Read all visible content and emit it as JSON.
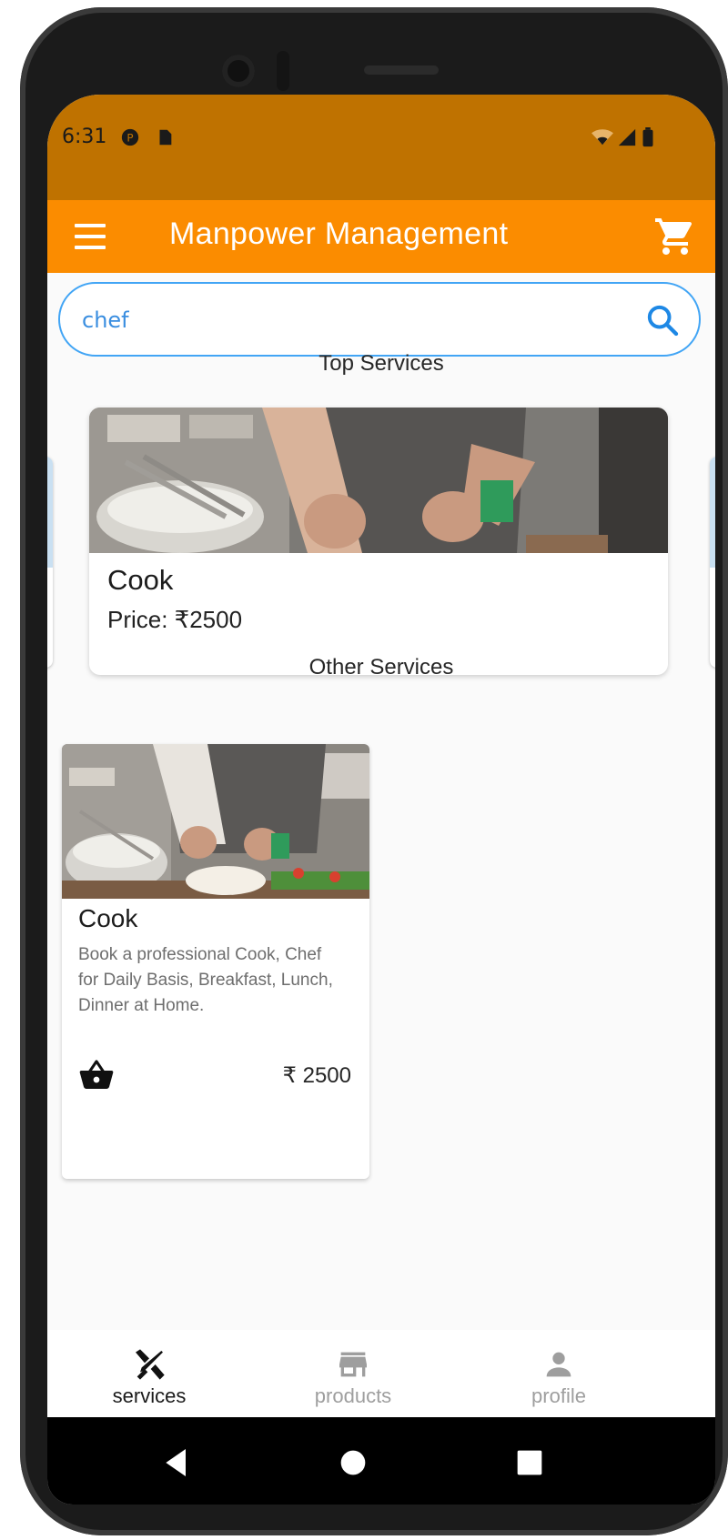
{
  "status_bar": {
    "time": "6:31"
  },
  "app_bar": {
    "title": "Manpower Management",
    "color": "#fb8c00",
    "status_color": "#bf7200"
  },
  "search": {
    "value": "chef",
    "placeholder": ""
  },
  "top_services": {
    "heading": "Top Services",
    "card": {
      "name": "Cook",
      "price": "Price: ₹2500"
    }
  },
  "other_services": {
    "heading": "Other Services",
    "card": {
      "name": "Cook",
      "description": "Book a professional Cook, Chef for Daily Basis, Breakfast, Lunch, Dinner at Home.",
      "price": "₹ 2500"
    }
  },
  "bottom_nav": {
    "items": [
      {
        "label": "services",
        "icon": "tools-icon",
        "active": true
      },
      {
        "label": "products",
        "icon": "store-icon",
        "active": false
      },
      {
        "label": "profile",
        "icon": "person-icon",
        "active": false
      }
    ],
    "active_color": "#1a1a1a",
    "inactive_color": "#9e9e9e"
  },
  "system_nav": {
    "icons": [
      "back-icon",
      "home-icon",
      "recents-icon"
    ]
  },
  "accent": {
    "search_border": "#42a5f5"
  }
}
